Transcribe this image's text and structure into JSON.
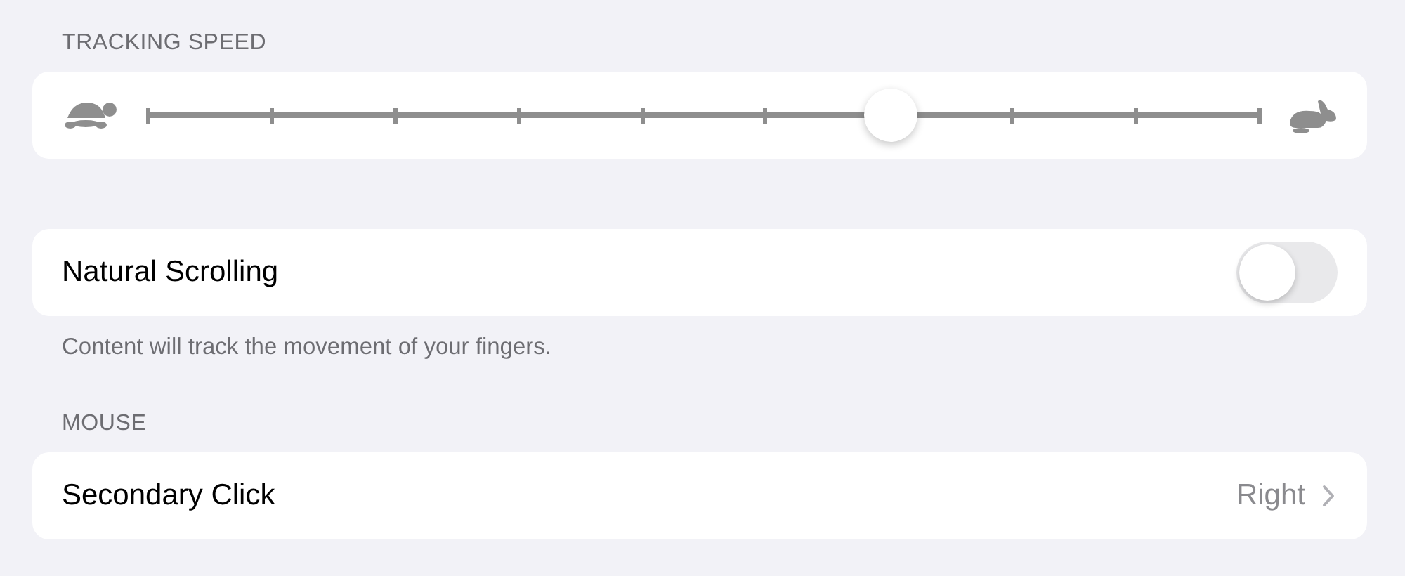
{
  "tracking_speed": {
    "header": "TRACKING SPEED",
    "slider": {
      "level": 0.667
    }
  },
  "natural_scrolling": {
    "label": "Natural Scrolling",
    "on": false,
    "footer": "Content will track the movement of your fingers."
  },
  "mouse": {
    "header": "MOUSE",
    "rows": [
      {
        "label": "Secondary Click",
        "value": "Right"
      }
    ]
  }
}
